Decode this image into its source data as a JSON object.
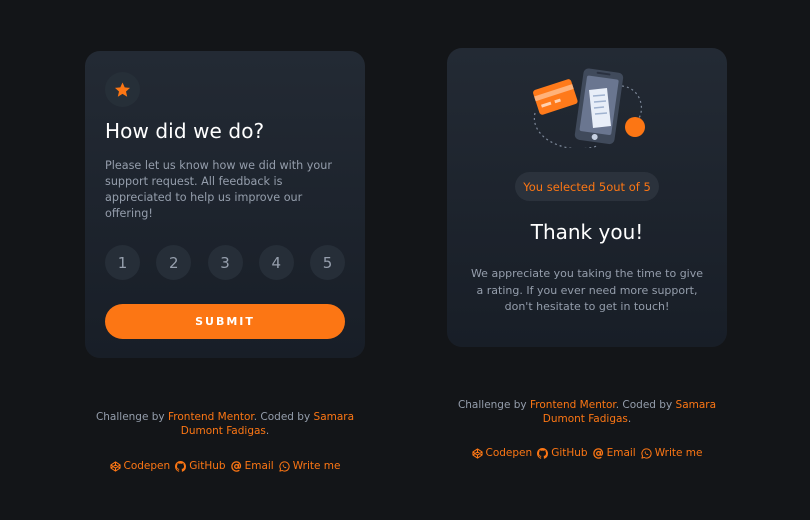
{
  "rating_card": {
    "title": "How did we do?",
    "description": "Please let us know how we did with your support request. All feedback is appreciated to help us improve our offering!",
    "ratings": [
      "1",
      "2",
      "3",
      "4",
      "5"
    ],
    "submit_label": "SUBMIT"
  },
  "thanks_card": {
    "selected_text": "You selected 5out of 5",
    "title": "Thank you!",
    "message": "We appreciate you taking the time to give a rating. If you ever need more support, don't hesitate to get in touch!"
  },
  "attribution": {
    "prefix": "Challenge by ",
    "challenge_link": "Frontend Mentor",
    "middle": ". Coded by ",
    "author_link": "Samara Dumont Fadigas",
    "suffix": "."
  },
  "social_links": {
    "codepen": "Codepen",
    "github": "GitHub",
    "email": "Email",
    "write": "Write me"
  },
  "icons": {
    "star": "star-icon",
    "illustration": "payment-phone-illustration",
    "codepen": "codepen-icon",
    "github": "github-icon",
    "email": "at-icon",
    "whatsapp": "whatsapp-icon"
  },
  "colors": {
    "background": "#131518",
    "card": "#1f252e",
    "accent": "#fc7614",
    "rating_bg": "#262e38",
    "text": "#959eac",
    "heading": "#ffffff"
  }
}
